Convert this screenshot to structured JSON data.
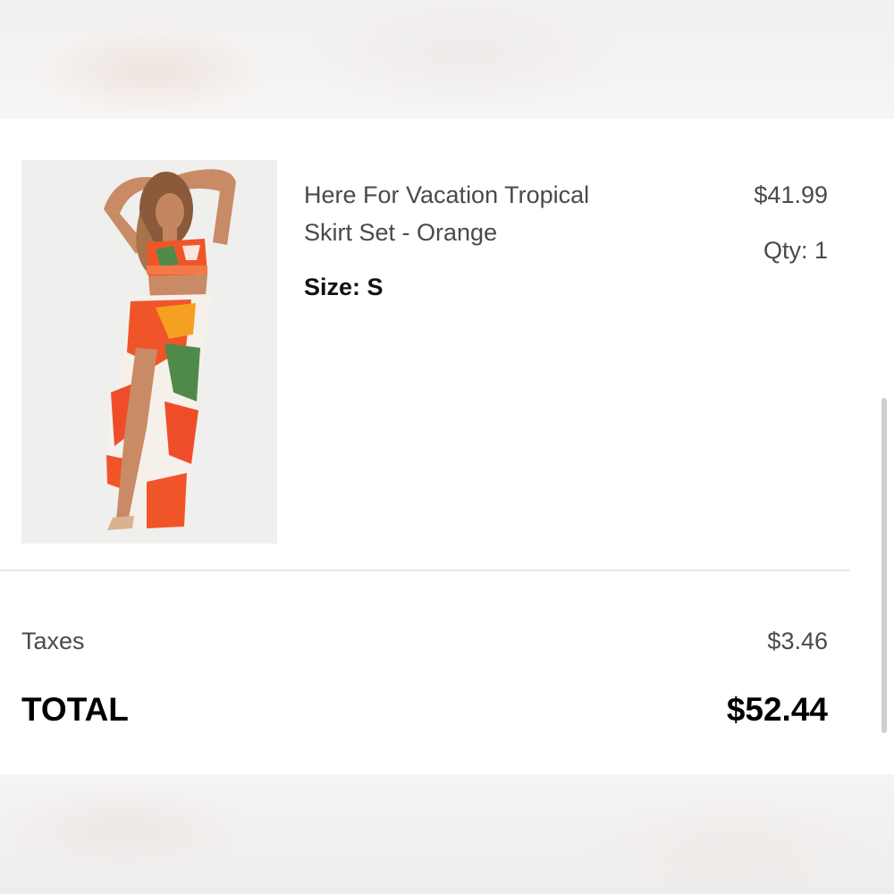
{
  "cart_item": {
    "name": "Here For Vacation Tropical Skirt Set - Orange",
    "size_label": "Size: S",
    "price": "$41.99",
    "quantity_label": "Qty: 1",
    "image_alt": "Model wearing orange tropical print crop top and maxi skirt"
  },
  "summary": {
    "taxes_label": "Taxes",
    "taxes_value": "$3.46",
    "total_label": "TOTAL",
    "total_value": "$52.44"
  },
  "colors": {
    "background": "#ffffff",
    "text_primary": "#000000",
    "text_secondary": "#4a4a4a",
    "divider": "#e6e6e6",
    "print_orange": "#f0552a",
    "print_green": "#4f8a4a"
  },
  "scrollbar": {
    "position_fraction": 0.55
  }
}
